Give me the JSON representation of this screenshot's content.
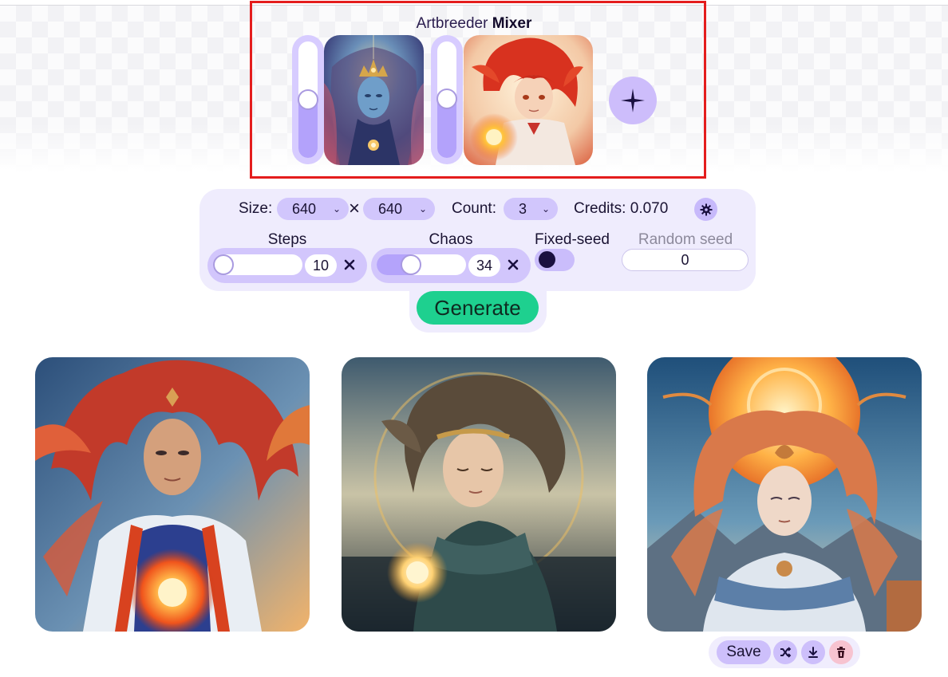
{
  "mixer": {
    "title_prefix": "Artbreeder",
    "title_bold": "Mixer"
  },
  "sources": [
    {
      "name": "celestial-queen",
      "weight": 0.5
    },
    {
      "name": "red-hair-fire-boy",
      "weight": 0.5
    }
  ],
  "settings": {
    "size_label": "Size:",
    "width": "640",
    "times": "×",
    "height": "640",
    "count_label": "Count:",
    "count": "3",
    "credits_label": "Credits:",
    "credits_value": "0.070",
    "steps_label": "Steps",
    "steps_value": "10",
    "steps_level": 0.0,
    "chaos_label": "Chaos",
    "chaos_value": "34",
    "chaos_level": 0.34,
    "fixed_seed_label": "Fixed-seed",
    "random_seed_label": "Random seed",
    "seed_value": "0"
  },
  "generate_label": "Generate",
  "results": [
    {
      "name": "fire-haired-figure-with-orb"
    },
    {
      "name": "brown-haired-boy-with-light"
    },
    {
      "name": "orange-haired-woman-sun-halo"
    }
  ],
  "result_actions": {
    "save_label": "Save"
  },
  "colors": {
    "accent": "#b4a3fb",
    "panel": "#efecfd",
    "generate": "#1ed08f",
    "highlight": "#e41d1d",
    "delete": "#f7c3d0"
  }
}
